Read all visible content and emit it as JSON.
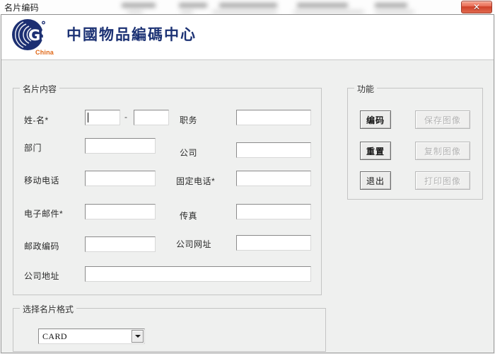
{
  "window": {
    "title": "名片编码",
    "close_label": "✕",
    "close_icon": "close-icon"
  },
  "banner": {
    "logo_text": "GS1",
    "logo_sub": "China",
    "logo_reg_mark": "®",
    "title": "中國物品編碼中心",
    "logo_color": "#1c2f72",
    "sub_color": "#e06817",
    "title_color": "#1c3274"
  },
  "content_group": {
    "label": "名片内容",
    "fields": [
      {
        "label": "姓-名*",
        "name": "surname",
        "value": "",
        "has_caret": true
      },
      {
        "label": "",
        "name": "givenname",
        "value": "",
        "has_caret": false
      },
      {
        "label": "部门",
        "name": "department",
        "value": "",
        "has_caret": false
      },
      {
        "label": "移动电话",
        "name": "mobile-phone",
        "value": "",
        "has_caret": false
      },
      {
        "label": "电子邮件*",
        "name": "email",
        "value": "",
        "has_caret": false
      },
      {
        "label": "邮政编码",
        "name": "postal-code",
        "value": "",
        "has_caret": false
      },
      {
        "label": "公司地址",
        "name": "company-address",
        "value": "",
        "has_caret": false
      },
      {
        "label": "职务",
        "name": "job-title",
        "value": "",
        "has_caret": false
      },
      {
        "label": "公司",
        "name": "company",
        "value": "",
        "has_caret": false
      },
      {
        "label": "固定电话*",
        "name": "landline",
        "value": "",
        "has_caret": false
      },
      {
        "label": "传真",
        "name": "fax",
        "value": "",
        "has_caret": false
      },
      {
        "label": "公司网址",
        "name": "company-url",
        "value": "",
        "has_caret": false
      }
    ],
    "separator": "-"
  },
  "function_group": {
    "label": "功能",
    "buttons": [
      {
        "label": "编码",
        "name": "encode-button",
        "enabled": true
      },
      {
        "label": "保存图像",
        "name": "save-image-button",
        "enabled": false
      },
      {
        "label": "重置",
        "name": "reset-button",
        "enabled": true
      },
      {
        "label": "复制图像",
        "name": "copy-image-button",
        "enabled": false
      },
      {
        "label": "退出",
        "name": "exit-button",
        "enabled": true
      },
      {
        "label": "打印图像",
        "name": "print-image-button",
        "enabled": false
      }
    ]
  },
  "format_group": {
    "label": "选择名片格式",
    "selected": "CARD",
    "options": [
      "CARD"
    ]
  }
}
